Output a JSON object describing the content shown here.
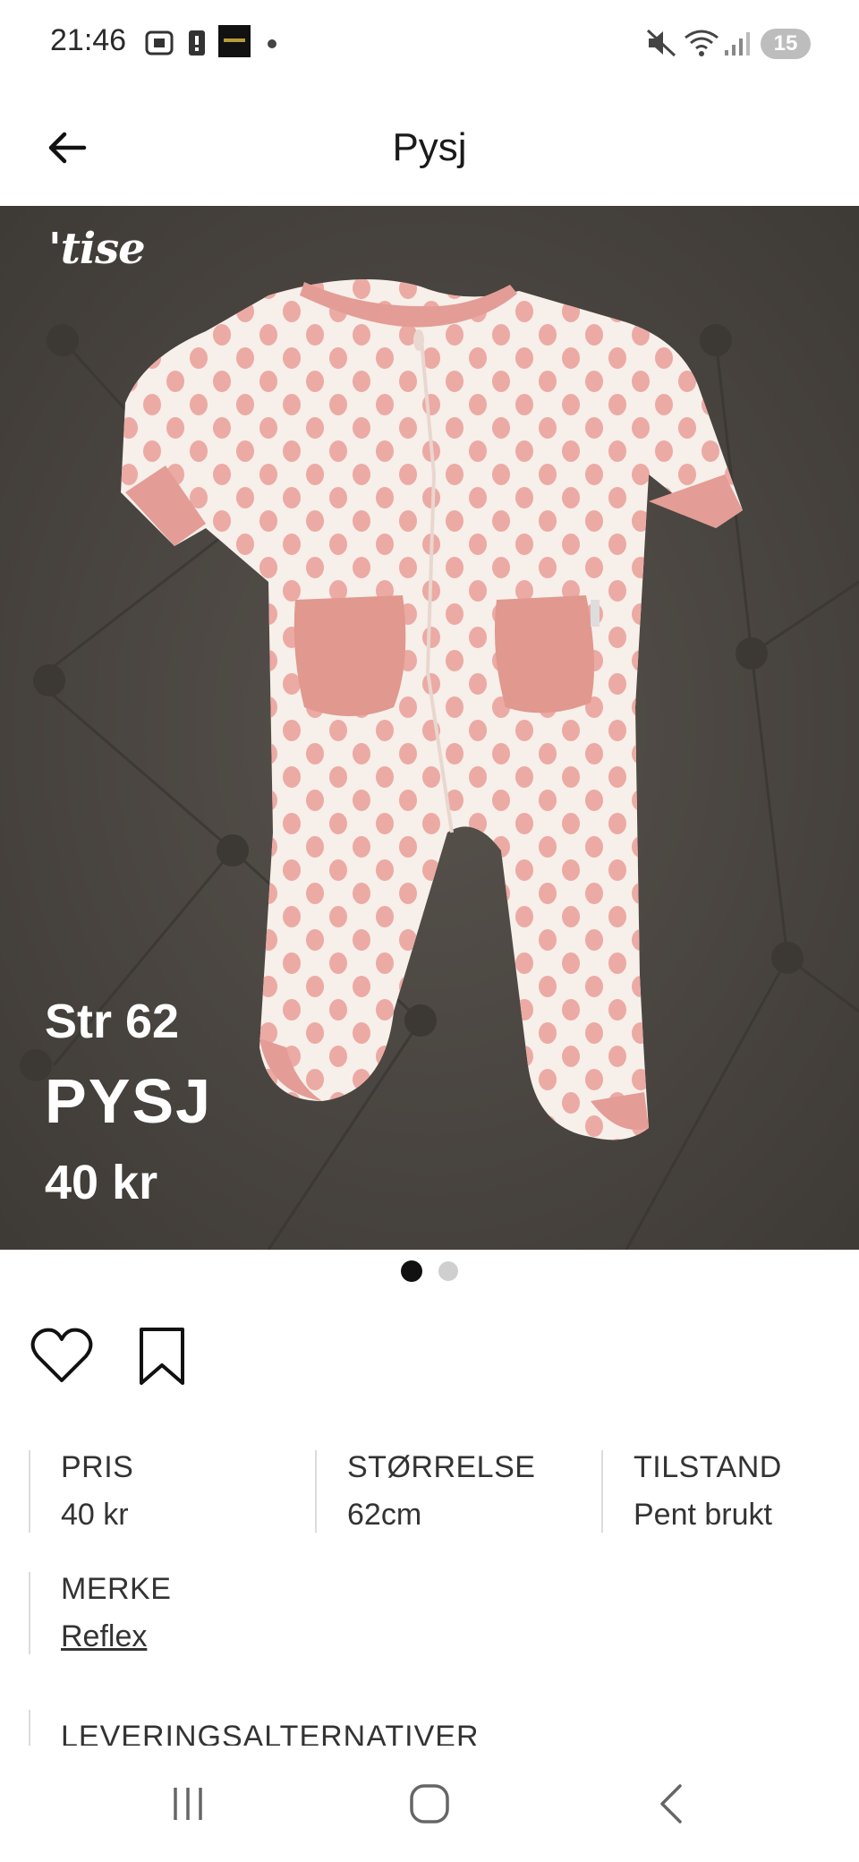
{
  "status_bar": {
    "time": "21:46",
    "notification_count": "15",
    "icons": [
      "screenshot-icon",
      "battery-alert-icon",
      "app-thumbnail-icon",
      "dot-icon",
      "mute-icon",
      "wifi-icon",
      "signal-icon"
    ]
  },
  "header": {
    "title": "Pysj",
    "back_icon": "arrow-left-icon"
  },
  "hero": {
    "brand": "'tise",
    "size_text": "Str 62",
    "name_text": "PYSJ",
    "price_text": "40 kr",
    "image_count": 2,
    "active_index": 0
  },
  "actions": {
    "like_icon": "heart-icon",
    "save_icon": "bookmark-icon"
  },
  "details": {
    "price_label": "PRIS",
    "price_value": "40 kr",
    "size_label": "STØRRELSE",
    "size_value": "62cm",
    "condition_label": "TILSTAND",
    "condition_value": "Pent brukt",
    "brand_label": "MERKE",
    "brand_value": "Reflex",
    "delivery_label": "LEVERINGSALTERNATIVER"
  },
  "nav": {
    "recents_icon": "recents-icon",
    "home_icon": "home-icon",
    "back_icon": "back-chevron-icon"
  }
}
